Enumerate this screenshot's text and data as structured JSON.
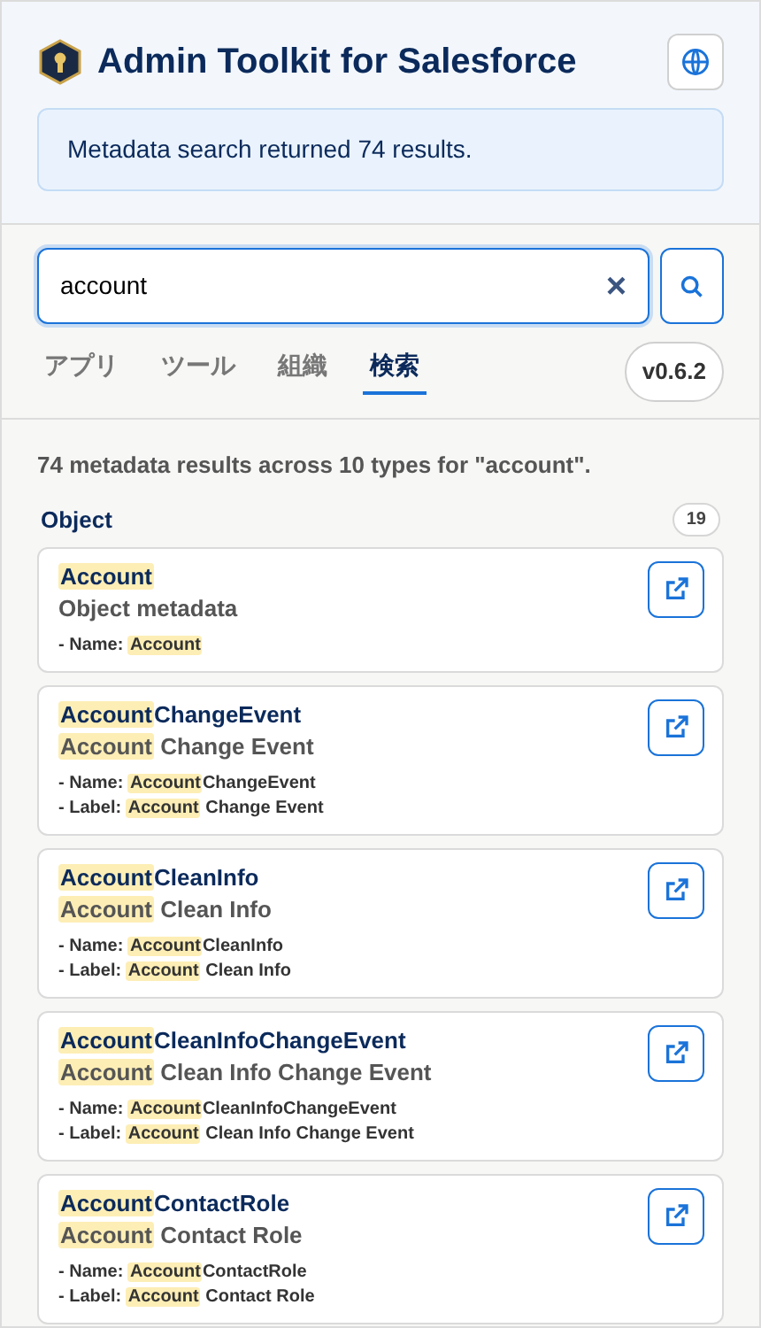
{
  "header": {
    "title": "Admin Toolkit for Salesforce",
    "notice": "Metadata search returned 74 results."
  },
  "search": {
    "value": "account",
    "clear": "×"
  },
  "tabs": [
    {
      "label": "アプリ",
      "selected": false
    },
    {
      "label": "ツール",
      "selected": false
    },
    {
      "label": "組織",
      "selected": false
    },
    {
      "label": "検索",
      "selected": true
    }
  ],
  "version": "v0.6.2",
  "summary": "74 metadata results across 10 types for \"account\".",
  "group": {
    "name": "Object",
    "count": "19"
  },
  "results": [
    {
      "title": [
        {
          "text": "Account",
          "highlight": true
        }
      ],
      "subtitle": [
        {
          "text": "Object metadata",
          "highlight": false
        }
      ],
      "details": [
        {
          "label": "- Name:",
          "value": [
            {
              "text": "Account",
              "highlight": true
            }
          ]
        }
      ]
    },
    {
      "title": [
        {
          "text": "Account",
          "highlight": true
        },
        {
          "text": "ChangeEvent",
          "highlight": false
        }
      ],
      "subtitle": [
        {
          "text": "Account",
          "highlight": true
        },
        {
          "text": " Change Event",
          "highlight": false
        }
      ],
      "details": [
        {
          "label": "- Name:",
          "value": [
            {
              "text": "Account",
              "highlight": true
            },
            {
              "text": "ChangeEvent",
              "highlight": false
            }
          ]
        },
        {
          "label": "- Label:",
          "value": [
            {
              "text": "Account",
              "highlight": true
            },
            {
              "text": " Change Event",
              "highlight": false
            }
          ]
        }
      ]
    },
    {
      "title": [
        {
          "text": "Account",
          "highlight": true
        },
        {
          "text": "CleanInfo",
          "highlight": false
        }
      ],
      "subtitle": [
        {
          "text": "Account",
          "highlight": true
        },
        {
          "text": " Clean Info",
          "highlight": false
        }
      ],
      "details": [
        {
          "label": "- Name:",
          "value": [
            {
              "text": "Account",
              "highlight": true
            },
            {
              "text": "CleanInfo",
              "highlight": false
            }
          ]
        },
        {
          "label": "- Label:",
          "value": [
            {
              "text": "Account",
              "highlight": true
            },
            {
              "text": " Clean Info",
              "highlight": false
            }
          ]
        }
      ]
    },
    {
      "title": [
        {
          "text": "Account",
          "highlight": true
        },
        {
          "text": "CleanInfoChangeEvent",
          "highlight": false
        }
      ],
      "subtitle": [
        {
          "text": "Account",
          "highlight": true
        },
        {
          "text": " Clean Info Change Event",
          "highlight": false
        }
      ],
      "details": [
        {
          "label": "- Name:",
          "value": [
            {
              "text": "Account",
              "highlight": true
            },
            {
              "text": "CleanInfoChangeEvent",
              "highlight": false
            }
          ]
        },
        {
          "label": "- Label:",
          "value": [
            {
              "text": "Account",
              "highlight": true
            },
            {
              "text": " Clean Info Change Event",
              "highlight": false
            }
          ]
        }
      ]
    },
    {
      "title": [
        {
          "text": "Account",
          "highlight": true
        },
        {
          "text": "ContactRole",
          "highlight": false
        }
      ],
      "subtitle": [
        {
          "text": "Account",
          "highlight": true
        },
        {
          "text": " Contact Role",
          "highlight": false
        }
      ],
      "details": [
        {
          "label": "- Name:",
          "value": [
            {
              "text": "Account",
              "highlight": true
            },
            {
              "text": "ContactRole",
              "highlight": false
            }
          ]
        },
        {
          "label": "- Label:",
          "value": [
            {
              "text": "Account",
              "highlight": true
            },
            {
              "text": " Contact Role",
              "highlight": false
            }
          ]
        }
      ]
    }
  ]
}
